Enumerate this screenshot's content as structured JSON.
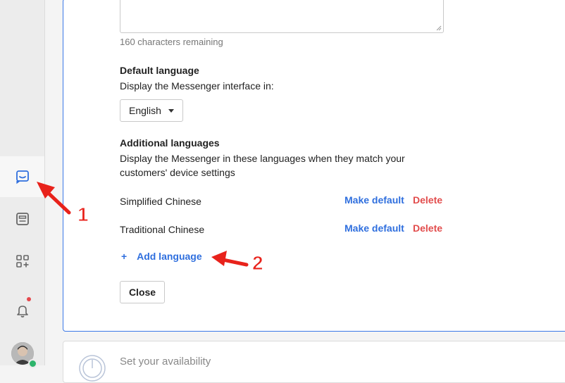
{
  "sidebar": {
    "items": [
      {
        "icon": "inbox-icon",
        "active": true
      },
      {
        "icon": "articles-icon",
        "active": false
      },
      {
        "icon": "apps-icon",
        "active": false
      },
      {
        "icon": "bell-icon",
        "active": false
      }
    ],
    "accent": "#2f6fde",
    "notification_color": "#e5484d",
    "online_color": "#2db46b"
  },
  "form": {
    "chars_remaining": "160 characters remaining",
    "default_language": {
      "title": "Default language",
      "description": "Display the Messenger interface in:",
      "selected": "English"
    },
    "additional_languages": {
      "title": "Additional languages",
      "description_line1": "Display the Messenger in these languages when they match your",
      "description_line2": "customers' device settings",
      "rows": [
        {
          "name": "Simplified Chinese",
          "make_default": "Make default",
          "delete": "Delete"
        },
        {
          "name": "Traditional Chinese",
          "make_default": "Make default",
          "delete": "Delete"
        }
      ]
    },
    "add_language": "Add language",
    "add_symbol": "+",
    "close_label": "Close"
  },
  "next_section": {
    "title": "Set your availability"
  },
  "annotations": {
    "one": "1",
    "two": "2"
  }
}
